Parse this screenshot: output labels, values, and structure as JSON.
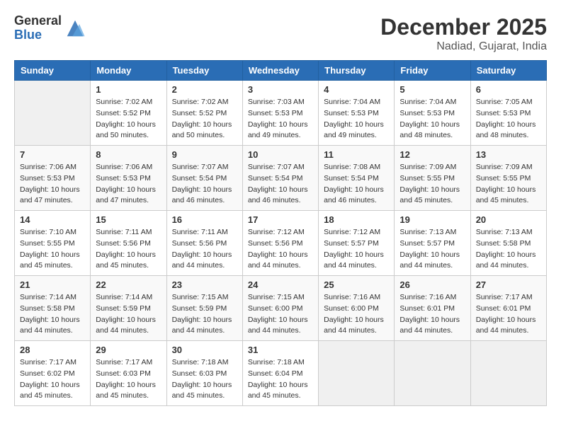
{
  "header": {
    "logo_general": "General",
    "logo_blue": "Blue",
    "month_title": "December 2025",
    "location": "Nadiad, Gujarat, India"
  },
  "days_of_week": [
    "Sunday",
    "Monday",
    "Tuesday",
    "Wednesday",
    "Thursday",
    "Friday",
    "Saturday"
  ],
  "weeks": [
    [
      {
        "day": "",
        "sunrise": "",
        "sunset": "",
        "daylight": ""
      },
      {
        "day": "1",
        "sunrise": "Sunrise: 7:02 AM",
        "sunset": "Sunset: 5:52 PM",
        "daylight": "Daylight: 10 hours and 50 minutes."
      },
      {
        "day": "2",
        "sunrise": "Sunrise: 7:02 AM",
        "sunset": "Sunset: 5:52 PM",
        "daylight": "Daylight: 10 hours and 50 minutes."
      },
      {
        "day": "3",
        "sunrise": "Sunrise: 7:03 AM",
        "sunset": "Sunset: 5:53 PM",
        "daylight": "Daylight: 10 hours and 49 minutes."
      },
      {
        "day": "4",
        "sunrise": "Sunrise: 7:04 AM",
        "sunset": "Sunset: 5:53 PM",
        "daylight": "Daylight: 10 hours and 49 minutes."
      },
      {
        "day": "5",
        "sunrise": "Sunrise: 7:04 AM",
        "sunset": "Sunset: 5:53 PM",
        "daylight": "Daylight: 10 hours and 48 minutes."
      },
      {
        "day": "6",
        "sunrise": "Sunrise: 7:05 AM",
        "sunset": "Sunset: 5:53 PM",
        "daylight": "Daylight: 10 hours and 48 minutes."
      }
    ],
    [
      {
        "day": "7",
        "sunrise": "Sunrise: 7:06 AM",
        "sunset": "Sunset: 5:53 PM",
        "daylight": "Daylight: 10 hours and 47 minutes."
      },
      {
        "day": "8",
        "sunrise": "Sunrise: 7:06 AM",
        "sunset": "Sunset: 5:53 PM",
        "daylight": "Daylight: 10 hours and 47 minutes."
      },
      {
        "day": "9",
        "sunrise": "Sunrise: 7:07 AM",
        "sunset": "Sunset: 5:54 PM",
        "daylight": "Daylight: 10 hours and 46 minutes."
      },
      {
        "day": "10",
        "sunrise": "Sunrise: 7:07 AM",
        "sunset": "Sunset: 5:54 PM",
        "daylight": "Daylight: 10 hours and 46 minutes."
      },
      {
        "day": "11",
        "sunrise": "Sunrise: 7:08 AM",
        "sunset": "Sunset: 5:54 PM",
        "daylight": "Daylight: 10 hours and 46 minutes."
      },
      {
        "day": "12",
        "sunrise": "Sunrise: 7:09 AM",
        "sunset": "Sunset: 5:55 PM",
        "daylight": "Daylight: 10 hours and 45 minutes."
      },
      {
        "day": "13",
        "sunrise": "Sunrise: 7:09 AM",
        "sunset": "Sunset: 5:55 PM",
        "daylight": "Daylight: 10 hours and 45 minutes."
      }
    ],
    [
      {
        "day": "14",
        "sunrise": "Sunrise: 7:10 AM",
        "sunset": "Sunset: 5:55 PM",
        "daylight": "Daylight: 10 hours and 45 minutes."
      },
      {
        "day": "15",
        "sunrise": "Sunrise: 7:11 AM",
        "sunset": "Sunset: 5:56 PM",
        "daylight": "Daylight: 10 hours and 45 minutes."
      },
      {
        "day": "16",
        "sunrise": "Sunrise: 7:11 AM",
        "sunset": "Sunset: 5:56 PM",
        "daylight": "Daylight: 10 hours and 44 minutes."
      },
      {
        "day": "17",
        "sunrise": "Sunrise: 7:12 AM",
        "sunset": "Sunset: 5:56 PM",
        "daylight": "Daylight: 10 hours and 44 minutes."
      },
      {
        "day": "18",
        "sunrise": "Sunrise: 7:12 AM",
        "sunset": "Sunset: 5:57 PM",
        "daylight": "Daylight: 10 hours and 44 minutes."
      },
      {
        "day": "19",
        "sunrise": "Sunrise: 7:13 AM",
        "sunset": "Sunset: 5:57 PM",
        "daylight": "Daylight: 10 hours and 44 minutes."
      },
      {
        "day": "20",
        "sunrise": "Sunrise: 7:13 AM",
        "sunset": "Sunset: 5:58 PM",
        "daylight": "Daylight: 10 hours and 44 minutes."
      }
    ],
    [
      {
        "day": "21",
        "sunrise": "Sunrise: 7:14 AM",
        "sunset": "Sunset: 5:58 PM",
        "daylight": "Daylight: 10 hours and 44 minutes."
      },
      {
        "day": "22",
        "sunrise": "Sunrise: 7:14 AM",
        "sunset": "Sunset: 5:59 PM",
        "daylight": "Daylight: 10 hours and 44 minutes."
      },
      {
        "day": "23",
        "sunrise": "Sunrise: 7:15 AM",
        "sunset": "Sunset: 5:59 PM",
        "daylight": "Daylight: 10 hours and 44 minutes."
      },
      {
        "day": "24",
        "sunrise": "Sunrise: 7:15 AM",
        "sunset": "Sunset: 6:00 PM",
        "daylight": "Daylight: 10 hours and 44 minutes."
      },
      {
        "day": "25",
        "sunrise": "Sunrise: 7:16 AM",
        "sunset": "Sunset: 6:00 PM",
        "daylight": "Daylight: 10 hours and 44 minutes."
      },
      {
        "day": "26",
        "sunrise": "Sunrise: 7:16 AM",
        "sunset": "Sunset: 6:01 PM",
        "daylight": "Daylight: 10 hours and 44 minutes."
      },
      {
        "day": "27",
        "sunrise": "Sunrise: 7:17 AM",
        "sunset": "Sunset: 6:01 PM",
        "daylight": "Daylight: 10 hours and 44 minutes."
      }
    ],
    [
      {
        "day": "28",
        "sunrise": "Sunrise: 7:17 AM",
        "sunset": "Sunset: 6:02 PM",
        "daylight": "Daylight: 10 hours and 45 minutes."
      },
      {
        "day": "29",
        "sunrise": "Sunrise: 7:17 AM",
        "sunset": "Sunset: 6:03 PM",
        "daylight": "Daylight: 10 hours and 45 minutes."
      },
      {
        "day": "30",
        "sunrise": "Sunrise: 7:18 AM",
        "sunset": "Sunset: 6:03 PM",
        "daylight": "Daylight: 10 hours and 45 minutes."
      },
      {
        "day": "31",
        "sunrise": "Sunrise: 7:18 AM",
        "sunset": "Sunset: 6:04 PM",
        "daylight": "Daylight: 10 hours and 45 minutes."
      },
      {
        "day": "",
        "sunrise": "",
        "sunset": "",
        "daylight": ""
      },
      {
        "day": "",
        "sunrise": "",
        "sunset": "",
        "daylight": ""
      },
      {
        "day": "",
        "sunrise": "",
        "sunset": "",
        "daylight": ""
      }
    ]
  ]
}
